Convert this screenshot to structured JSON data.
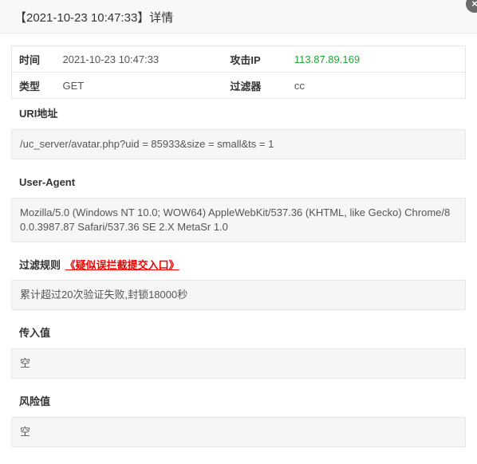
{
  "dialog": {
    "title": "【2021-10-23 10:47:33】详情",
    "close_label": "×"
  },
  "info": {
    "time_label": "时间",
    "time_value": "2021-10-23 10:47:33",
    "ip_label": "攻击IP",
    "ip_value": "113.87.89.169",
    "type_label": "类型",
    "type_value": "GET",
    "filter_label": "过滤器",
    "filter_value": "cc"
  },
  "uri": {
    "label": "URI地址",
    "value": "/uc_server/avatar.php?uid = 85933&size = small&ts = 1"
  },
  "user_agent": {
    "label": "User-Agent",
    "value": "Mozilla/5.0 (Windows NT 10.0; WOW64) AppleWebKit/537.36 (KHTML, like Gecko) Chrome/80.0.3987.87 Safari/537.36 SE 2.X MetaSr 1.0"
  },
  "rule": {
    "label": "过滤规则",
    "link": "《疑似误拦截提交入口》",
    "value": "累计超过20次验证失败,封锁18000秒"
  },
  "input_value": {
    "label": "传入值",
    "value": "空"
  },
  "risk_value": {
    "label": "风险值",
    "value": "空"
  },
  "colors": {
    "ip": "#20a53a",
    "link": "#ee0000"
  }
}
